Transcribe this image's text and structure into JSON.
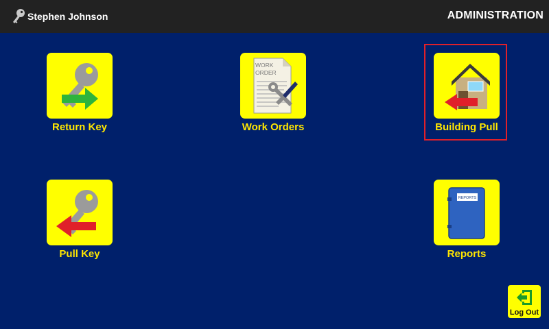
{
  "header": {
    "user_name": "Stephen Johnson",
    "user_icon": "key-icon",
    "section_title": "ADMINISTRATION"
  },
  "tiles": [
    {
      "label": "Return Key",
      "icon": "return-key-icon"
    },
    {
      "label": "Work Orders",
      "icon": "work-orders-icon",
      "icon_text": [
        "WORK",
        "ORDER"
      ]
    },
    {
      "label": "Building Pull",
      "icon": "building-pull-icon",
      "selected": true
    },
    {
      "label": "Pull Key",
      "icon": "pull-key-icon"
    },
    {
      "label": "Reports",
      "icon": "reports-icon",
      "icon_text": "REPORTS"
    }
  ],
  "logout": {
    "label": "Log Out",
    "icon": "logout-icon"
  },
  "colors": {
    "background": "#00206b",
    "topbar": "#222222",
    "tile": "#ffff00",
    "label": "#ffe600",
    "selection": "#e0202a"
  }
}
